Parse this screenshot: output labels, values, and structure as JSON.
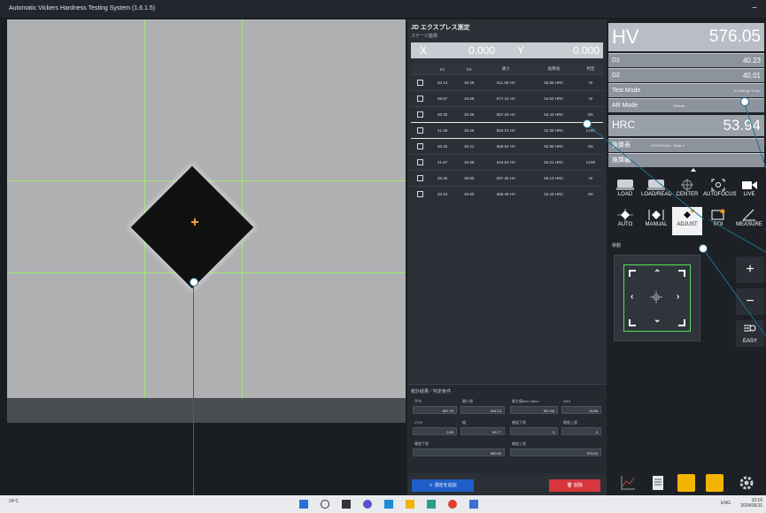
{
  "window": {
    "title": "Automatic Vickers Hardness Testing System (1.6.1.5)",
    "minimize_icon": "minimize-icon"
  },
  "measure": {
    "header": "JD エクスプレス測定",
    "stage_label": "ステージ座標",
    "x_label": "X",
    "x_value": "0.000",
    "y_label": "Y",
    "y_value": "0.000",
    "columns": [
      "",
      "D1",
      "D2",
      "硬さ",
      "換算値",
      "判定"
    ],
    "rows": [
      [
        "40.14",
        "40.45",
        "611.09 HV",
        "55.65 HRC",
        "HI"
      ],
      [
        "39.87",
        "40.68",
        "577.34 HV",
        "54.02 HRC",
        "HI"
      ],
      [
        "40.30",
        "40.36",
        "567.25 HV",
        "53.43 HRC",
        "OK"
      ],
      [
        "41.49",
        "40.45",
        "553.21 HV",
        "52.38 HRC",
        "LOW"
      ],
      [
        "40.36",
        "40.41",
        "568.52 HV",
        "52.98 HRC",
        "OK"
      ],
      [
        "41.87",
        "40.89",
        "544.53 HV",
        "52.01 HRC",
        "LOW"
      ],
      [
        "39.35",
        "39.60",
        "597.36 HV",
        "55.13 HRC",
        "HI"
      ],
      [
        "40.63",
        "40.80",
        "565.49 HV",
        "53.28 HRC",
        "OK"
      ]
    ],
    "selected_row": 3
  },
  "stats": {
    "title": "統計結果／判定条件",
    "labels": {
      "avg": "平均",
      "min": "最小値",
      "max": "最大値Max Value",
      "sd": "(SD)",
      "cv": "CV%",
      "range": "幅",
      "lower": "硬度下限",
      "upper": "硬度上限",
      "lower2": "硬度下限",
      "upper2": "硬度上限"
    },
    "values": {
      "avg": "567.79",
      "min": "544.13",
      "max": "597.90",
      "sd": "15.88",
      "cv": "2.80",
      "range": "53.77",
      "lower": "3",
      "upper": "3",
      "lower2": "580.00",
      "upper2": "575.00"
    },
    "add_button": "＋ 測定を追加",
    "delete_button": "削除"
  },
  "result": {
    "hv_label": "HV",
    "hv_value": "576.05",
    "d1_label": "D1",
    "d1_value": "40.23",
    "d2_label": "D2",
    "d2_value": "40.01",
    "test_mode_label": "Test Mode",
    "test_mode_value": "HV 500 gf / 5 sec",
    "ar_mode_label": "AR Mode",
    "ar_mode_value": "Default",
    "hrc_label": "HRC",
    "hrc_value": "53.94",
    "conv_label": "換算表",
    "conv_value": "ASTM E140 - Table 1",
    "conv_scale_label": "換算値",
    "conv_scale_value": "HRC"
  },
  "toolbar": {
    "load": "LOAD",
    "loadread": "LOAD/READ",
    "center": "CENTER",
    "autofocus": "AUTOFOCUS",
    "live": "LIVE",
    "auto": "AUTO",
    "manual": "MANUAL",
    "adjust": "ADJUST",
    "roi": "ROI",
    "measure": "MEASURE"
  },
  "stage": {
    "label": "移動",
    "zoom_in": "+",
    "zoom_out": "−",
    "easy": "EASY"
  },
  "taskbar": {
    "weather": "24°C",
    "lang": "ENG",
    "time": "10:16",
    "date": "2024/06/11"
  }
}
